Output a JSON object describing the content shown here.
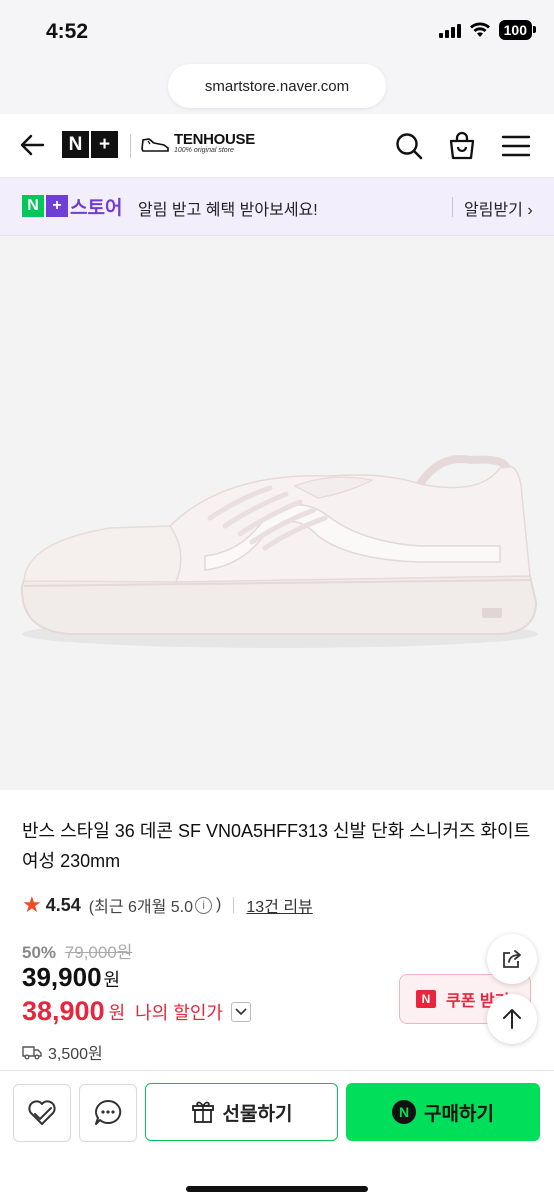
{
  "status": {
    "time": "4:52",
    "battery": "100"
  },
  "browser": {
    "url": "smartstore.naver.com"
  },
  "header": {
    "nplus_n": "N",
    "nplus_plus": "+",
    "brand_name": "TENHOUSE",
    "brand_tagline": "100% original store"
  },
  "notice": {
    "logo_n": "N",
    "logo_plus": "+",
    "store": "스토어",
    "message": "알림 받고 혜택 받아보세요!",
    "action": "알림받기 ›"
  },
  "product": {
    "title": "반스 스타일 36 데콘 SF VN0A5HFF313 신발 단화 스니커즈 화이트 여성 230mm",
    "rating": "4.54",
    "recent": "(최근 6개월 5.0",
    "recent_close": ")",
    "info_mark": "i",
    "reviews": "13건 리뷰",
    "discount_pct": "50%",
    "original_price": "79,000원",
    "price": "39,900",
    "price_unit": "원",
    "my_price": "38,900",
    "my_price_unit": "원",
    "my_price_label": "나의 할인가",
    "shipping": "3,500원"
  },
  "coupon": {
    "badge": "N",
    "label": "쿠폰 받기"
  },
  "bottom": {
    "gift_label": "선물하기",
    "buy_label": "구매하기",
    "buy_icon": "N"
  },
  "colors": {
    "naver_green": "#03c75a",
    "buy_green": "#00de5a",
    "price_red": "#e8253c",
    "notice_bg": "#f2eefb",
    "store_purple": "#6f3ed6",
    "star": "#f04b24"
  }
}
